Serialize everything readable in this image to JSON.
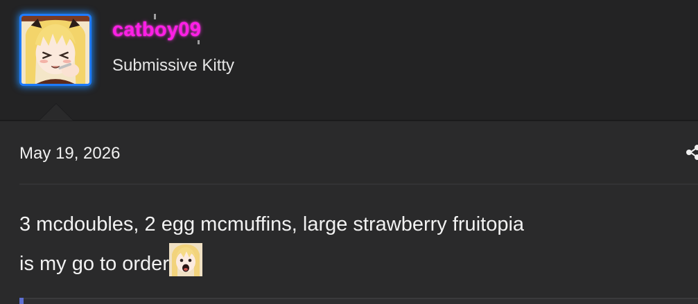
{
  "author": {
    "username": "catboy09",
    "user_title": "Submissive Kitty",
    "username_color": "#ff1ee6",
    "avatar_border_color": "#1e7bff",
    "avatar_icon": "anime-girl-avatar"
  },
  "post": {
    "date": "May 19, 2026",
    "share_icon": "share-icon",
    "content_lines": [
      "3 mcdoubles, 2 egg mcmuffins, large strawberry fruitopia",
      "is my go to order"
    ],
    "emoji_icon": "anime-girl-emoji"
  }
}
